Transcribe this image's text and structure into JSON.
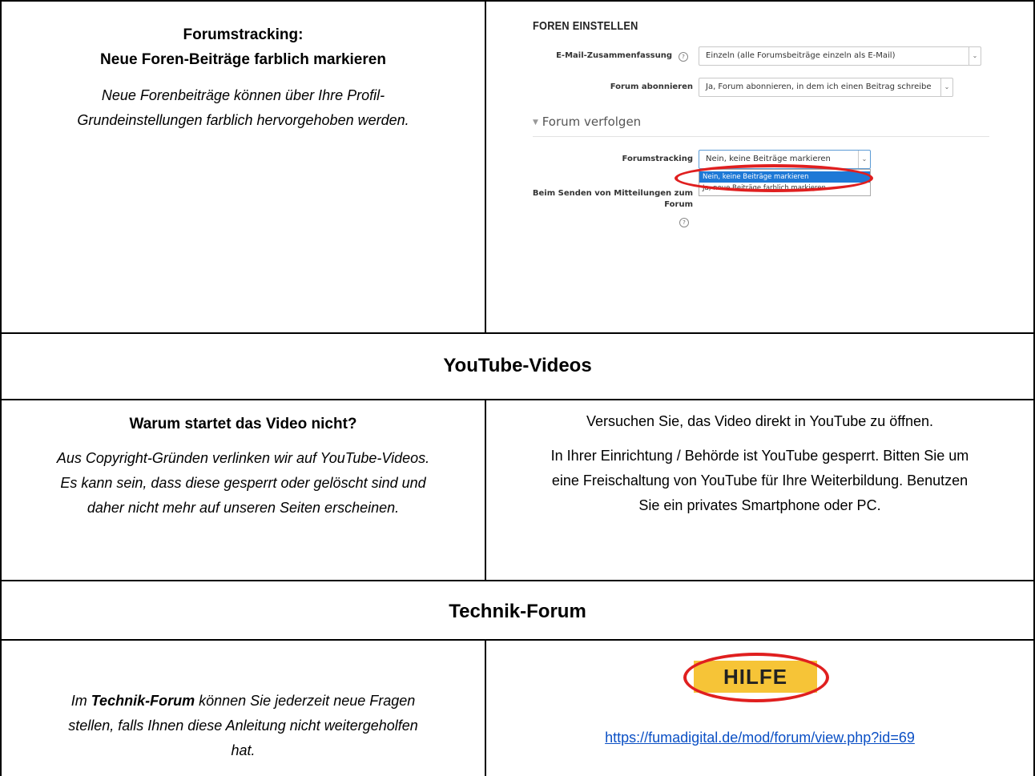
{
  "row1": {
    "left": {
      "title_line1": "Forumstracking:",
      "title_line2": "Neue Foren-Beiträge farblich markieren",
      "desc_line1": "Neue Forenbeiträge können über Ihre Profil-",
      "desc_line2": "Grundeinstellungen farblich hervorgehoben werden."
    },
    "screenshot": {
      "heading": "FOREN EINSTELLEN",
      "digest_label": "E-Mail-Zusammenfassung",
      "digest_value": "Einzeln (alle Forumsbeiträge einzeln als E-Mail)",
      "subscribe_label": "Forum abonnieren",
      "subscribe_value": "Ja, Forum abonnieren, in dem ich einen Beitrag schreibe",
      "section_title": "Forum verfolgen",
      "tracking_label": "Forumstracking",
      "tracking_value": "Nein, keine Beiträge markieren",
      "tracking_options": [
        "Nein, keine Beiträge markieren",
        "Ja, neue Beiträge farblich markieren"
      ],
      "send_label_line1": "Beim Senden von Mitteilungen zum",
      "send_label_line2": "Forum",
      "help_glyph": "?",
      "arrow_glyph": "⌄",
      "icons": [
        "help-icon",
        "chevron-down-icon",
        "caret-down-icon"
      ]
    }
  },
  "band_youtube": "YouTube-Videos",
  "row2": {
    "left": {
      "title": "Warum startet das Video nicht?",
      "desc_line1": "Aus Copyright-Gründen verlinken wir auf YouTube-Videos.",
      "desc_line2": "Es kann sein, dass diese gesperrt oder gelöscht sind und",
      "desc_line3": "daher nicht mehr auf unseren Seiten erscheinen."
    },
    "right": {
      "para1": "Versuchen Sie, das Video direkt in YouTube zu öffnen.",
      "para2_line1": "In Ihrer Einrichtung / Behörde ist YouTube gesperrt. Bitten Sie um",
      "para2_line2": "eine Freischaltung von YouTube für Ihre Weiterbildung. Benutzen",
      "para2_line3": "Sie ein privates Smartphone oder PC."
    }
  },
  "band_technik": "Technik-Forum",
  "row3": {
    "left": {
      "line1_pre": "Im ",
      "line1_bold": "Technik-Forum",
      "line1_post": " können Sie jederzeit neue Fragen",
      "line2": "stellen, falls Ihnen diese Anleitung nicht weitergeholfen",
      "line3": "hat."
    },
    "right": {
      "button_label": "HILFE",
      "url": "https://fumadigital.de/mod/forum/view.php?id=69"
    }
  },
  "colors": {
    "highlight_ring": "#e01f1f",
    "hilfe_bg": "#f6c437",
    "link": "#0b50c5",
    "dropdown_selected": "#1e79d6"
  }
}
